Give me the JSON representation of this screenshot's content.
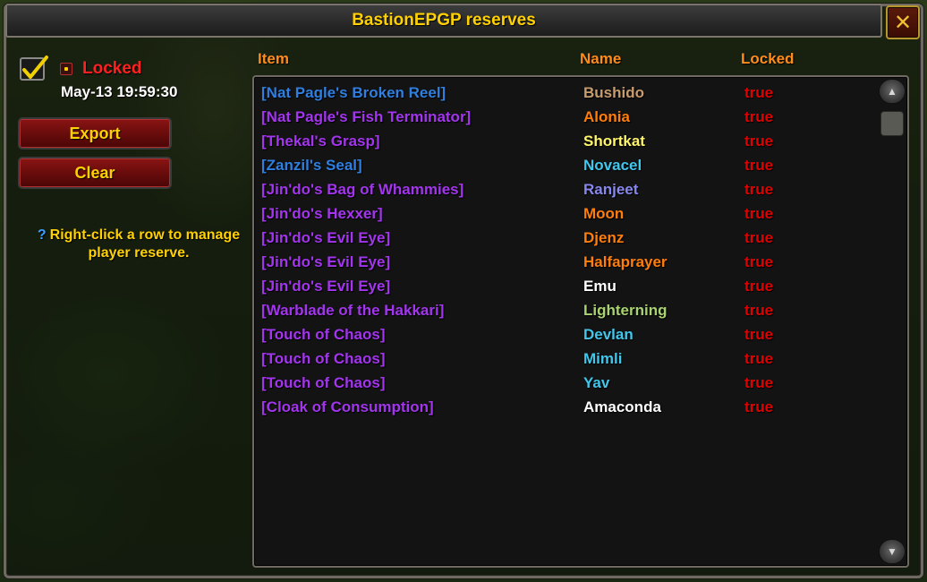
{
  "window": {
    "title": "BastionEPGP reserves",
    "close_glyph": "✕"
  },
  "status": {
    "checked": true,
    "lock_label": "Locked",
    "timestamp": "May-13 19:59:30"
  },
  "buttons": {
    "export_label": "Export",
    "clear_label": "Clear"
  },
  "hint": {
    "icon": "?",
    "text": "Right-click a row to manage player reserve."
  },
  "columns": {
    "item": "Item",
    "name": "Name",
    "locked": "Locked"
  },
  "colors": {
    "rare": "#2f7fe0",
    "epic": "#a335ee",
    "locked_true": "#e00000",
    "header": "#ff8c1a",
    "gold": "#ffd100"
  },
  "rows": [
    {
      "item": "[Nat Pagle's Broken Reel]",
      "item_color": "#2f7fe0",
      "name": "Bushido",
      "name_color": "#c79c6e",
      "locked": "true"
    },
    {
      "item": "[Nat Pagle's Fish Terminator]",
      "item_color": "#a335ee",
      "name": "Alonia",
      "name_color": "#ff7d0a",
      "locked": "true"
    },
    {
      "item": "[Thekal's Grasp]",
      "item_color": "#a335ee",
      "name": "Shortkat",
      "name_color": "#fff569",
      "locked": "true"
    },
    {
      "item": "[Zanzil's Seal]",
      "item_color": "#2f7fe0",
      "name": "Novacel",
      "name_color": "#40c7eb",
      "locked": "true"
    },
    {
      "item": "[Jin'do's Bag of Whammies]",
      "item_color": "#a335ee",
      "name": "Ranjeet",
      "name_color": "#8787ed",
      "locked": "true"
    },
    {
      "item": "[Jin'do's Hexxer]",
      "item_color": "#a335ee",
      "name": "Moon",
      "name_color": "#ff7d0a",
      "locked": "true"
    },
    {
      "item": "[Jin'do's Evil Eye]",
      "item_color": "#a335ee",
      "name": "Djenz",
      "name_color": "#ff7d0a",
      "locked": "true"
    },
    {
      "item": "[Jin'do's Evil Eye]",
      "item_color": "#a335ee",
      "name": "Halfaprayer",
      "name_color": "#ff7d0a",
      "locked": "true"
    },
    {
      "item": "[Jin'do's Evil Eye]",
      "item_color": "#a335ee",
      "name": "Emu",
      "name_color": "#ffffff",
      "locked": "true"
    },
    {
      "item": "[Warblade of the Hakkari]",
      "item_color": "#a335ee",
      "name": "Lighterning",
      "name_color": "#a9d271",
      "locked": "true"
    },
    {
      "item": "[Touch of Chaos]",
      "item_color": "#a335ee",
      "name": "Devlan",
      "name_color": "#40c7eb",
      "locked": "true"
    },
    {
      "item": "[Touch of Chaos]",
      "item_color": "#a335ee",
      "name": "Mimli",
      "name_color": "#40c7eb",
      "locked": "true"
    },
    {
      "item": "[Touch of Chaos]",
      "item_color": "#a335ee",
      "name": "Yav",
      "name_color": "#40c7eb",
      "locked": "true"
    },
    {
      "item": "[Cloak of Consumption]",
      "item_color": "#a335ee",
      "name": "Amaconda",
      "name_color": "#ffffff",
      "locked": "true"
    }
  ],
  "scroll": {
    "up_glyph": "▲",
    "down_glyph": "▼"
  }
}
